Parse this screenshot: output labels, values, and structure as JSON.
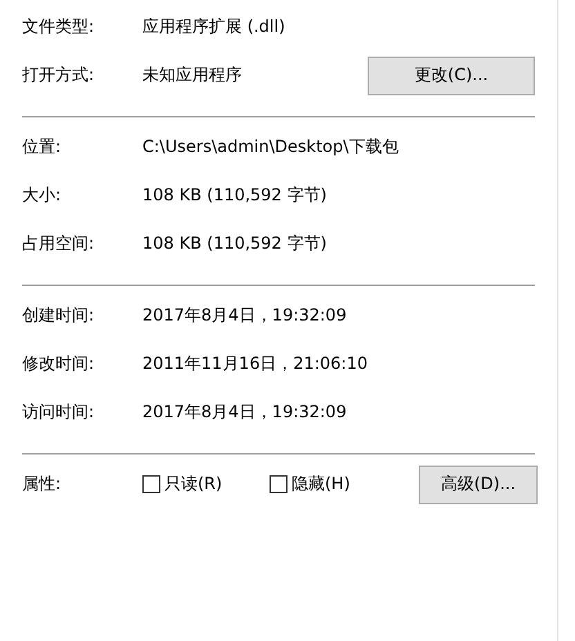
{
  "groups": [
    {
      "rows": [
        {
          "label": "文件类型:",
          "value": "应用程序扩展 (.dll)"
        },
        {
          "label": "打开方式:",
          "value": "未知应用程序",
          "button": "更改(C)..."
        }
      ]
    },
    {
      "rows": [
        {
          "label": "位置:",
          "value": "C:\\Users\\admin\\Desktop\\下载包"
        },
        {
          "label": "大小:",
          "value": "108 KB (110,592 字节)"
        },
        {
          "label": "占用空间:",
          "value": "108 KB (110,592 字节)"
        }
      ]
    },
    {
      "rows": [
        {
          "label": "创建时间:",
          "value": "2017年8月4日，19:32:09"
        },
        {
          "label": "修改时间:",
          "value": "2011年11月16日，21:06:10"
        },
        {
          "label": "访问时间:",
          "value": "2017年8月4日，19:32:09"
        }
      ]
    }
  ],
  "attributes": {
    "label": "属性:",
    "checkboxes": [
      {
        "label": "只读(R)",
        "checked": false
      },
      {
        "label": "隐藏(H)",
        "checked": false
      }
    ],
    "button": "高级(D)..."
  }
}
